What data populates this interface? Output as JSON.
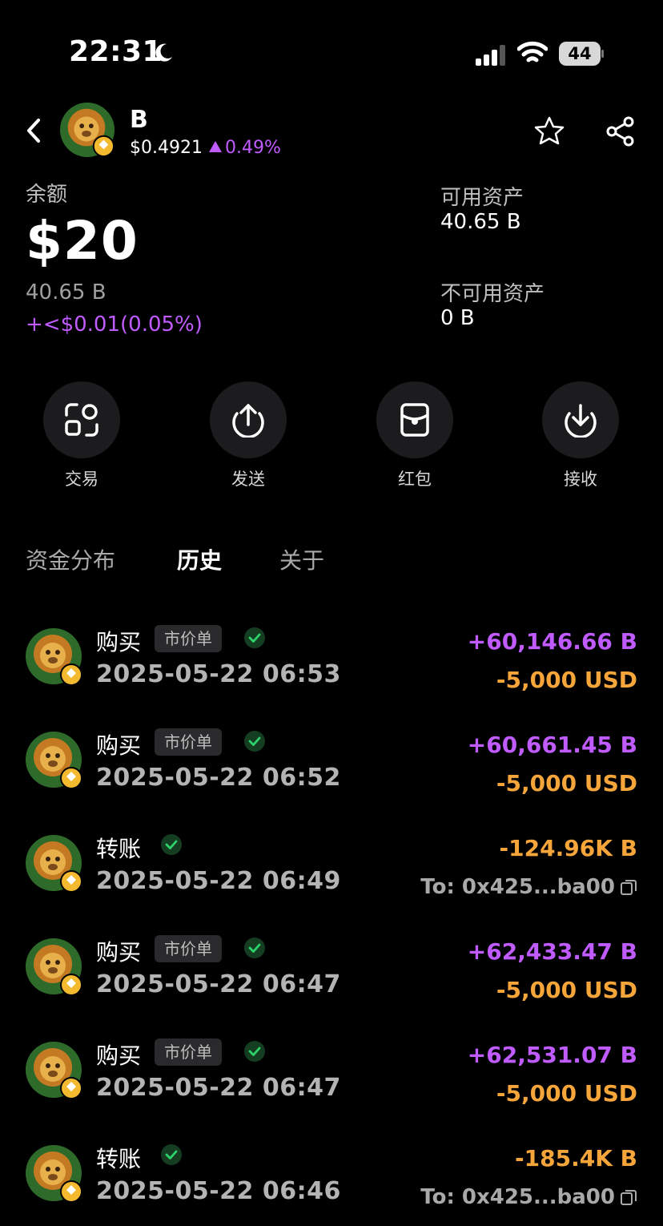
{
  "status_bar": {
    "time": "22:31",
    "battery": "44"
  },
  "header": {
    "token_name": "B",
    "price": "$0.4921",
    "change": "0.49%"
  },
  "balance": {
    "label": "余额",
    "value": "$20",
    "amount": "40.65 B",
    "change": "+<$0.01(0.05%)"
  },
  "assets": {
    "available_label": "可用资产",
    "available_value": "40.65 B",
    "unavailable_label": "不可用资产",
    "unavailable_value": "0 B"
  },
  "actions": [
    {
      "label": "交易",
      "icon": "trade-icon"
    },
    {
      "label": "发送",
      "icon": "send-icon"
    },
    {
      "label": "红包",
      "icon": "red-packet-icon"
    },
    {
      "label": "接收",
      "icon": "receive-icon"
    }
  ],
  "tabs": [
    {
      "label": "资金分布",
      "active": false
    },
    {
      "label": "历史",
      "active": true
    },
    {
      "label": "关于",
      "active": false
    }
  ],
  "transactions": [
    {
      "type": "购买",
      "tag": "市价单",
      "date": "2025-05-22 06:53",
      "amount": "+60,146.66 B",
      "sub": "-5,000 USD"
    },
    {
      "type": "购买",
      "tag": "市价单",
      "date": "2025-05-22 06:52",
      "amount": "+60,661.45 B",
      "sub": "-5,000 USD"
    },
    {
      "type": "转账",
      "tag": "",
      "date": "2025-05-22 06:49",
      "amount": "-124.96K B",
      "sub": "To: 0x425...ba00"
    },
    {
      "type": "购买",
      "tag": "市价单",
      "date": "2025-05-22 06:47",
      "amount": "+62,433.47 B",
      "sub": "-5,000 USD"
    },
    {
      "type": "购买",
      "tag": "市价单",
      "date": "2025-05-22 06:47",
      "amount": "+62,531.07 B",
      "sub": "-5,000 USD"
    },
    {
      "type": "转账",
      "tag": "",
      "date": "2025-05-22 06:46",
      "amount": "-185.4K B",
      "sub": "To: 0x425...ba00"
    }
  ],
  "colors": {
    "accent_purple": "#c05cff",
    "accent_orange": "#f6a53a",
    "background": "#000000"
  }
}
